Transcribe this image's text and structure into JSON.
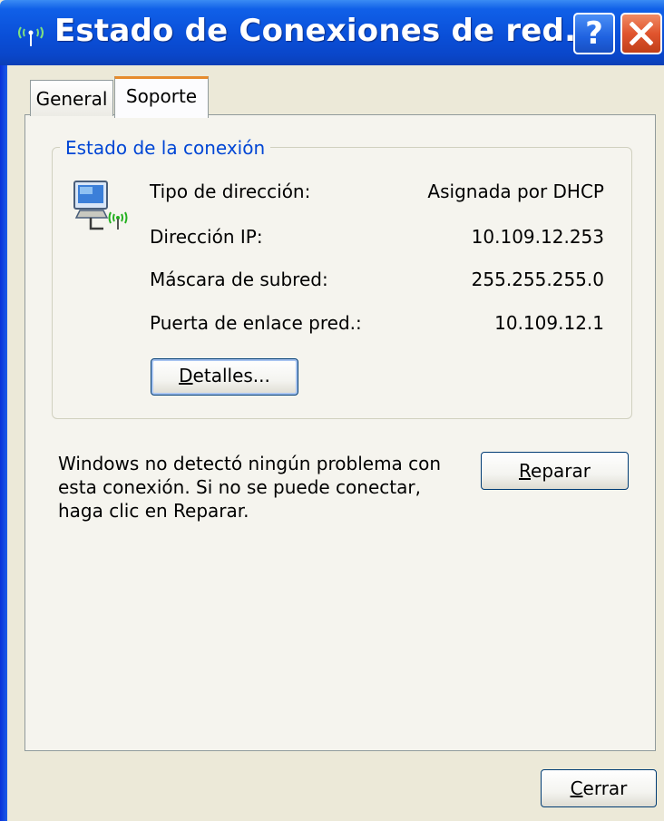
{
  "window": {
    "title": "Estado de Conexiones de red...",
    "title_icon": "wireless-network-icon",
    "help_button": "?",
    "close_button": "close-icon"
  },
  "tabs": [
    {
      "label": "General",
      "selected": false
    },
    {
      "label": "Soporte",
      "selected": true
    }
  ],
  "connection_status": {
    "group_title": "Estado de la conexión",
    "icon": "network-connection-icon",
    "rows": [
      {
        "label": "Tipo de dirección:",
        "value": "Asignada por DHCP"
      },
      {
        "label": "Dirección IP:",
        "value": "10.109.12.253"
      },
      {
        "label": "Máscara de subred:",
        "value": "255.255.255.0"
      },
      {
        "label": "Puerta de enlace pred.:",
        "value": "10.109.12.1"
      }
    ],
    "details_button": {
      "mnemonic": "D",
      "rest": "etalles..."
    }
  },
  "repair": {
    "message": "Windows no detectó ningún problema con esta conexión. Si no se puede conectar, haga clic en Reparar.",
    "button": {
      "mnemonic": "R",
      "rest": "eparar"
    }
  },
  "close_button": {
    "mnemonic": "C",
    "rest": "errar"
  },
  "colors": {
    "titlebar": "#0a4fd8",
    "group_title": "#0046d5",
    "dialog_bg": "#ece9d8",
    "active_tab_accent": "#e68b2c"
  }
}
